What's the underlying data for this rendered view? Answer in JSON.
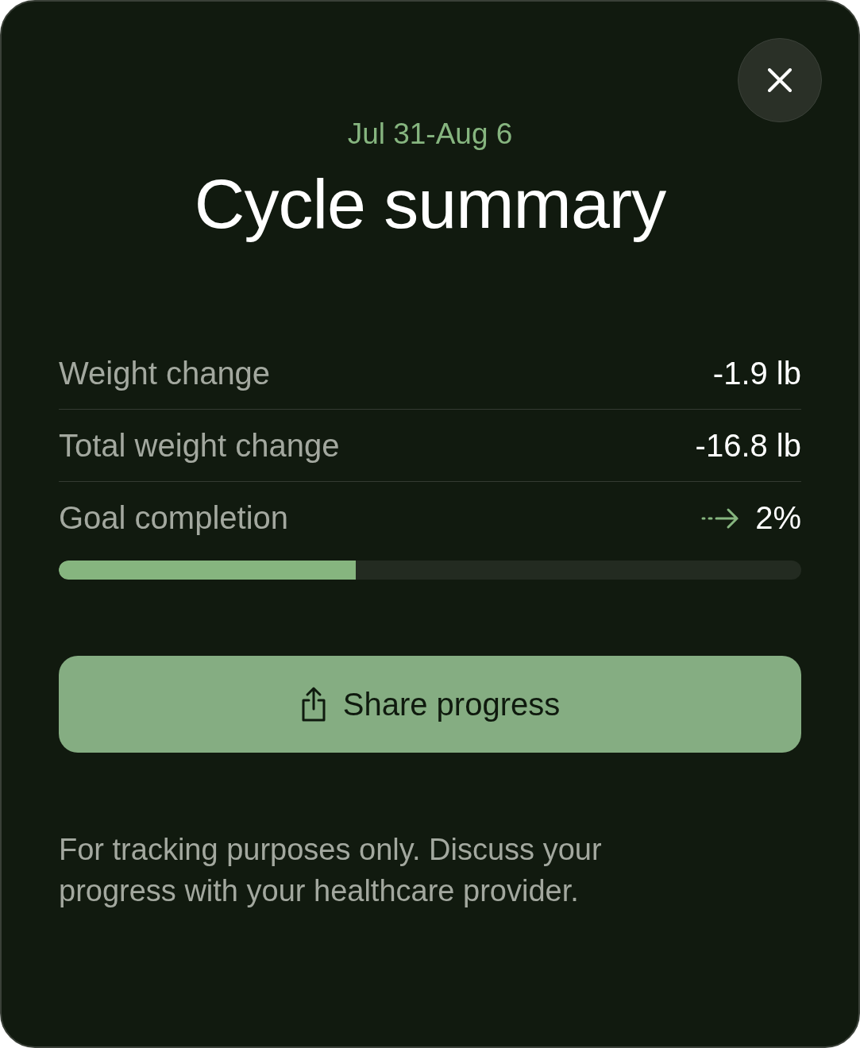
{
  "dialog": {
    "date_range": "Jul 31-Aug 6",
    "title": "Cycle summary"
  },
  "stats": [
    {
      "label": "Weight change",
      "value": "-1.9 lb",
      "kind": "plain"
    },
    {
      "label": "Total weight change",
      "value": "-16.8 lb",
      "kind": "plain"
    },
    {
      "label": "Goal completion",
      "value": "2%",
      "kind": "trend"
    }
  ],
  "goal_progress": {
    "level": 0.4
  },
  "share_button": {
    "label": "Share progress"
  },
  "disclaimer": "For tracking purposes only. Discuss your progress with your healthcare provider."
}
